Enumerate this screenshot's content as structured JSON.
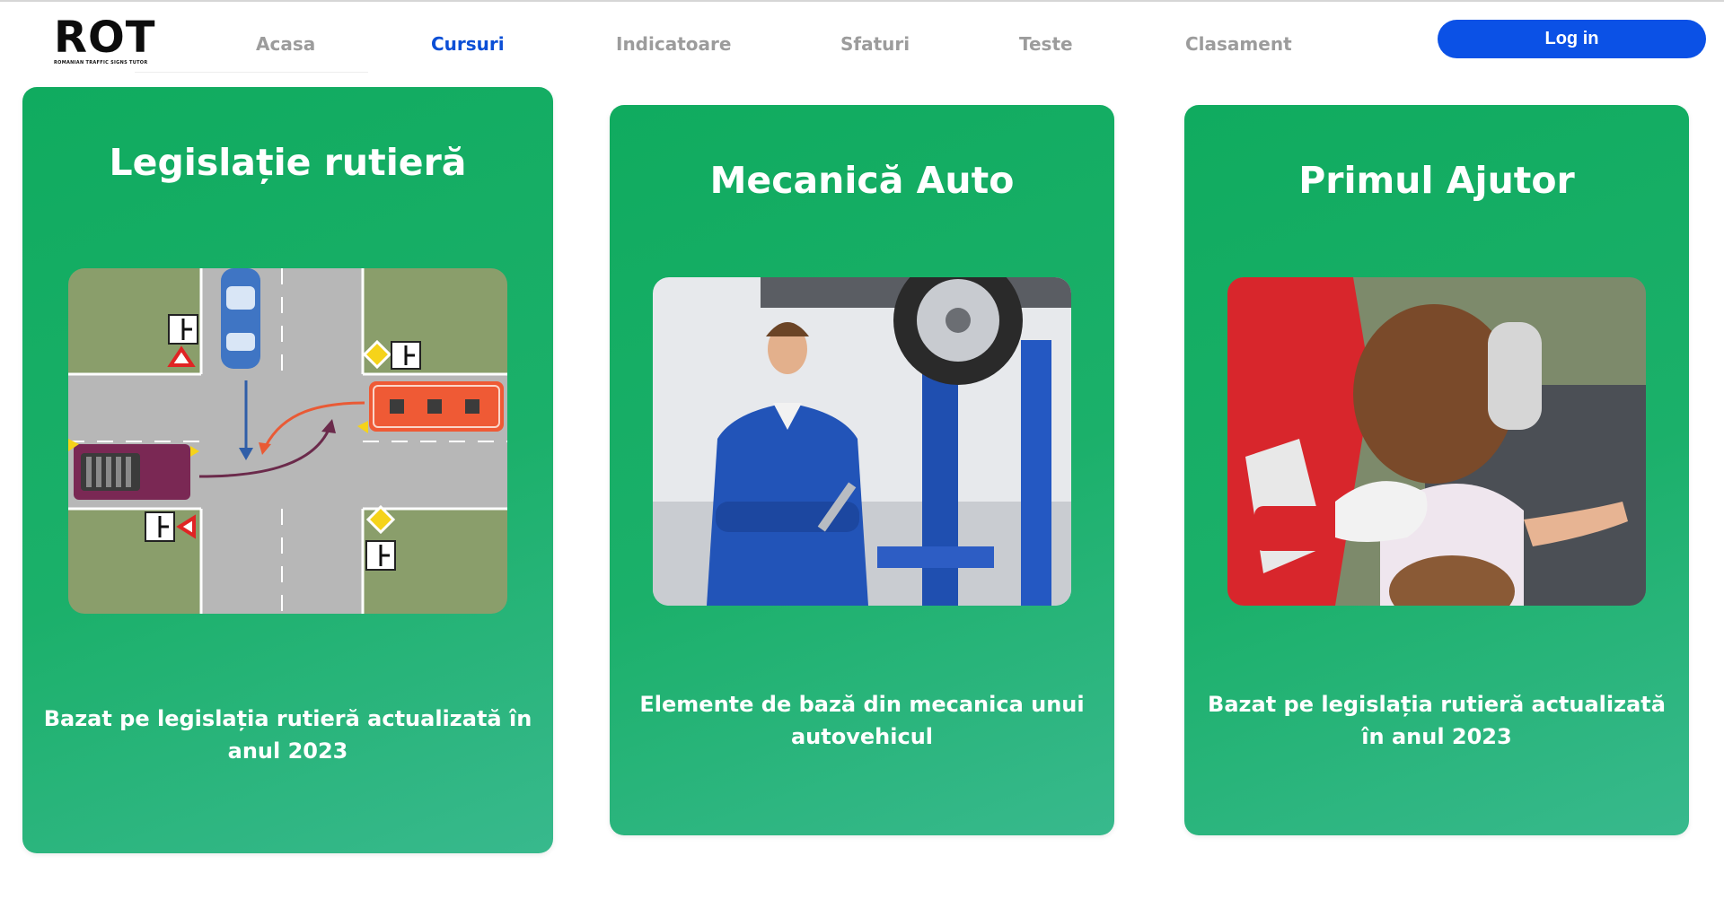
{
  "header": {
    "logo_text": "ROT",
    "logo_subtitle": "ROMANIAN TRAFFIC SIGNS TUTOR",
    "nav": [
      {
        "label": "Acasa",
        "active": false
      },
      {
        "label": "Cursuri",
        "active": true
      },
      {
        "label": "Indicatoare",
        "active": false
      },
      {
        "label": "Sfaturi",
        "active": false
      },
      {
        "label": "Teste",
        "active": false
      },
      {
        "label": "Clasament",
        "active": false
      }
    ],
    "login_label": "Log in"
  },
  "courses": [
    {
      "title": "Legislație rutieră",
      "description": "Bazat pe legislația rutieră actualizată în anul 2023",
      "image": "intersection-illustration"
    },
    {
      "title": "Mecanică Auto",
      "description": "Elemente de bază din mecanica unui autovehicul",
      "image": "mechanic-photo"
    },
    {
      "title": "Primul Ajutor",
      "description": "Bazat pe legislația rutieră actualizată în anul 2023",
      "image": "first-aid-photo"
    }
  ],
  "colors": {
    "card_green": "#10ab5f",
    "active_nav": "#0b4fd6",
    "login_button": "#0b51e6",
    "nav_inactive": "#9c9c9c"
  }
}
